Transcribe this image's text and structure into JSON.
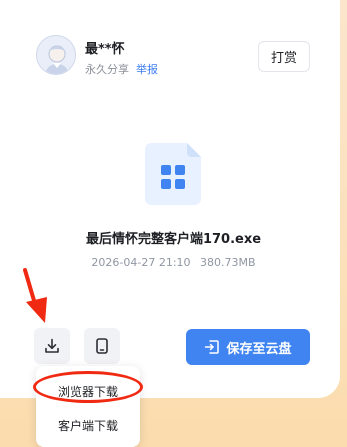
{
  "user": {
    "name": "最**怀",
    "share_type": "永久分享",
    "report_label": "举报"
  },
  "tip_button_label": "打赏",
  "file": {
    "name": "最后情怀完整客户端170.exe",
    "date": "2026-04-27 21:10",
    "size": "380.73MB",
    "icon": "app-file-icon"
  },
  "actions": {
    "download_icon": "download-icon",
    "client_icon": "phone-icon",
    "save_label": "保存至云盘",
    "save_icon": "cloud-save-icon"
  },
  "download_menu": {
    "items": [
      "浏览器下载",
      "客户端下载"
    ]
  },
  "colors": {
    "accent": "#3f84f0",
    "link": "#3f7ef0",
    "annotation": "#f02a12",
    "background_gradient": "#fbdcae"
  }
}
